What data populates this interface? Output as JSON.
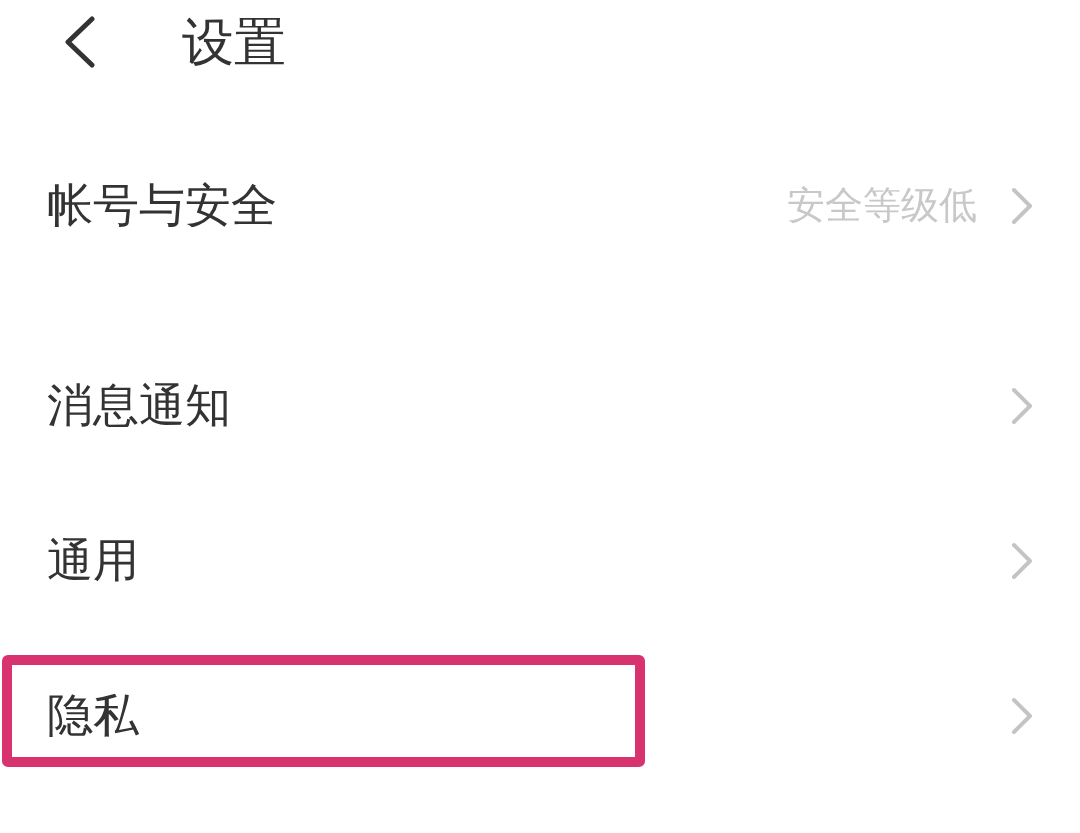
{
  "header": {
    "title": "设置"
  },
  "sections": [
    {
      "items": [
        {
          "label": "帐号与安全",
          "value": "安全等级低",
          "highlighted": false
        }
      ]
    },
    {
      "items": [
        {
          "label": "消息通知",
          "highlighted": false
        },
        {
          "label": "通用",
          "highlighted": false
        },
        {
          "label": "隐私",
          "highlighted": true
        }
      ]
    }
  ]
}
